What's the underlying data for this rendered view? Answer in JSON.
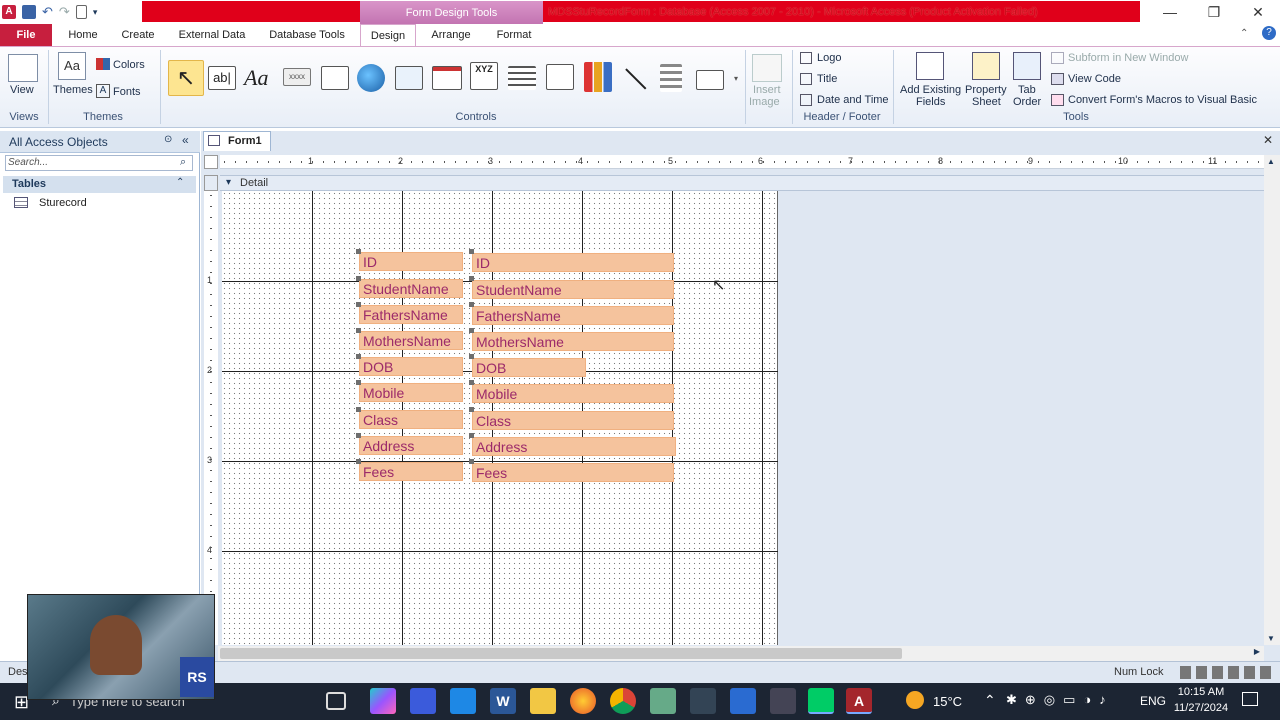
{
  "window": {
    "title": "MDSStuRecordForm : Database (Access 2007 - 2010) - Microsoft Access (Product Activation Failed)",
    "context_tab": "Form Design Tools"
  },
  "tabs": [
    "File",
    "Home",
    "Create",
    "External Data",
    "Database Tools",
    "Design",
    "Arrange",
    "Format"
  ],
  "ribbon": {
    "views": {
      "view_label": "View",
      "group": "Views"
    },
    "themes": {
      "themes_label": "Themes",
      "colors_label": "Colors",
      "fonts_label": "Fonts",
      "group": "Themes"
    },
    "controls": {
      "group": "Controls",
      "textbox_glyph": "ab|",
      "label_glyph": "Aa",
      "button_glyph": "xxxx",
      "optgroup_glyph": "XYZ"
    },
    "insert_image": {
      "line1": "Insert",
      "line2": "Image"
    },
    "header_footer": {
      "logo": "Logo",
      "title": "Title",
      "datetime": "Date and Time",
      "group": "Header / Footer"
    },
    "tools": {
      "add_existing": "Add Existing",
      "fields": "Fields",
      "property": "Property",
      "sheet": "Sheet",
      "tab": "Tab",
      "order": "Order",
      "subform": "Subform in New Window",
      "view_code": "View Code",
      "convert": "Convert Form's Macros to Visual Basic",
      "group": "Tools"
    }
  },
  "nav": {
    "title": "All Access Objects",
    "search_placeholder": "Search...",
    "section": "Tables",
    "items": [
      "Sturecord"
    ]
  },
  "document": {
    "tab": "Form1",
    "section": "Detail",
    "ruler_h": [
      "1",
      "2",
      "3",
      "4",
      "5",
      "6",
      "7",
      "8",
      "9",
      "10",
      "11"
    ],
    "ruler_v": [
      "1",
      "2",
      "3",
      "4"
    ],
    "labels": [
      "ID",
      "StudentName",
      "FathersName",
      "MothersName",
      "DOB",
      "Mobile",
      "Class",
      "Address",
      "Fees"
    ],
    "textboxes": [
      "ID",
      "StudentName",
      "FathersName",
      "MothersName",
      "DOB",
      "Mobile",
      "Class",
      "Address",
      "Fees"
    ]
  },
  "status": {
    "left": "Des",
    "numlock": "Num Lock"
  },
  "taskbar": {
    "search_placeholder": "Type here to search",
    "weather": "15°C",
    "lang": "ENG",
    "time": "10:15 AM",
    "date": "11/27/2024"
  },
  "colors": {
    "file_tab": "#c71f3e",
    "context": "#c374b2",
    "field_fill": "#f5c39d",
    "field_text": "#9c2a6a"
  }
}
